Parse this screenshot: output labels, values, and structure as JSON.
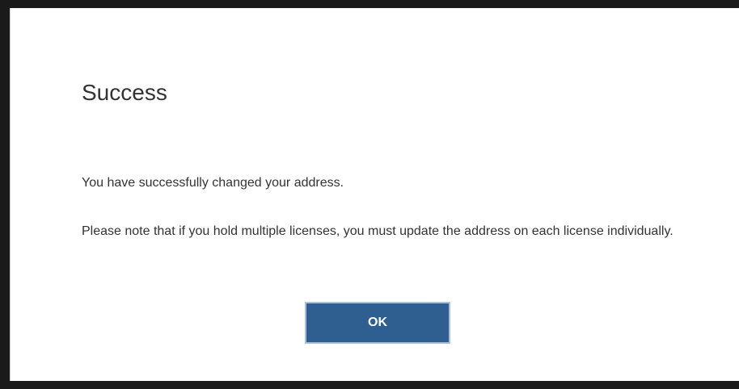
{
  "dialog": {
    "title": "Success",
    "message_1": "You have successfully changed your address.",
    "message_2": "Please note that if you hold multiple licenses, you must update the address on each license individually.",
    "ok_label": "OK"
  },
  "colors": {
    "button_background": "#2f5f91",
    "button_text": "#ffffff",
    "text": "#333333"
  }
}
